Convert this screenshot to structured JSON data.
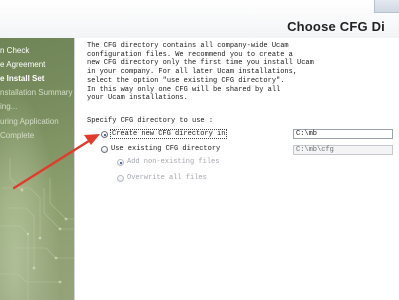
{
  "header": {
    "title": "Choose CFG Di"
  },
  "nav": {
    "items": [
      {
        "label": "n Check"
      },
      {
        "label": "e Agreement"
      },
      {
        "label": "e Install Set"
      },
      {
        "label": "nstallation Summary"
      },
      {
        "label": "ing..."
      },
      {
        "label": "uring Application"
      },
      {
        "label": "Complete"
      }
    ]
  },
  "content": {
    "description": [
      "The CFG directory contains all company-wide Ucam",
      "configuration files. We recommend you to create a",
      "new CFG directory only the first time you install Ucam",
      "in your company. For all later Ucam installations,",
      "select the option \"use existing CFG directory\".",
      "In this way only one CFG will be shared by all",
      "your Ucam installations."
    ],
    "specify_label": "Specify CFG directory to use :",
    "options": {
      "create_new": {
        "label": "Create new CFG directory in",
        "path": "C:\\mb",
        "selected": true
      },
      "use_existing": {
        "label": "Use existing CFG directory",
        "path": "C:\\mb\\cfg",
        "selected": false
      },
      "add_non_existing": {
        "label": "Add non-existing files",
        "selected": true
      },
      "overwrite_all": {
        "label": "Overwrite all files",
        "selected": false
      }
    }
  },
  "colors": {
    "annotation_arrow": "#e23a2c",
    "nav_green": "#7b8f60",
    "radio_dot": "#1b3f8f"
  }
}
